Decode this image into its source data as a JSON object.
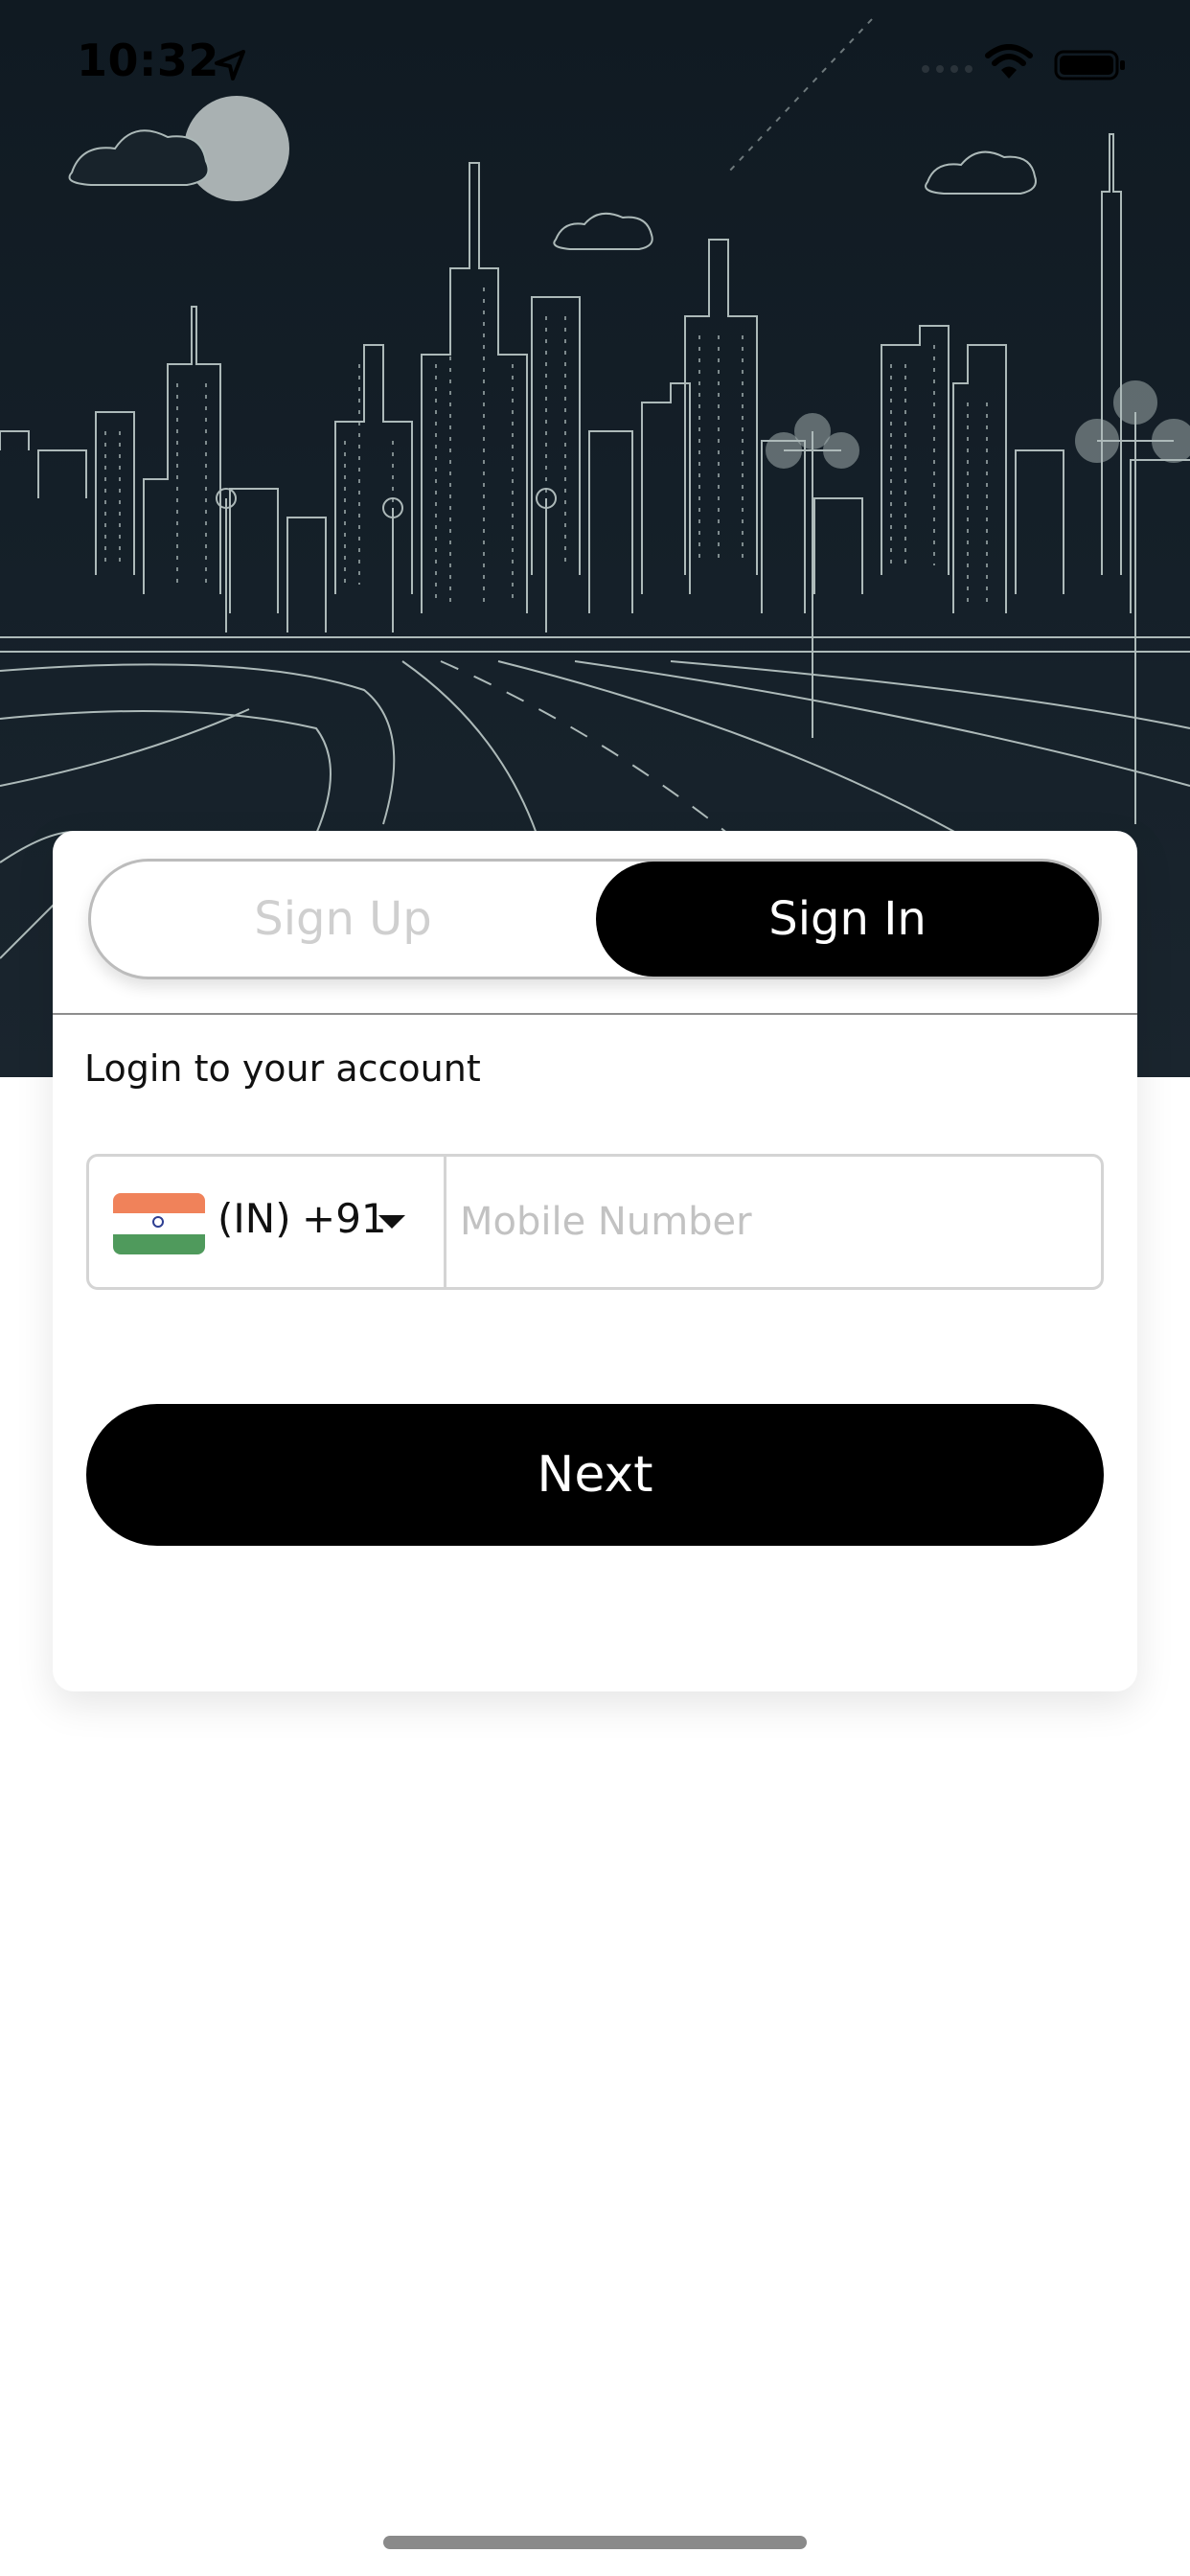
{
  "status_bar": {
    "time": "10:32",
    "icons": [
      "location-arrow-icon",
      "signal-icon",
      "wifi-icon",
      "battery-icon"
    ]
  },
  "hero": {
    "illustration": "night-city-skyline"
  },
  "auth_toggle": {
    "sign_up_label": "Sign Up",
    "sign_in_label": "Sign In",
    "selected": "Sign In"
  },
  "login": {
    "title": "Login to your account",
    "country": {
      "flag": "india-flag-icon",
      "code": "(IN)",
      "dial_code": "+91"
    },
    "mobile": {
      "value": "",
      "placeholder": "Mobile Number"
    },
    "next_label": "Next"
  },
  "colors": {
    "primary": "#000000",
    "background": "#ffffff",
    "hero_background": "#152029",
    "hero_lines": "#c9d6d4",
    "placeholder": "#c2c2c2",
    "inactive_tab_text": "#cfcfcf"
  }
}
